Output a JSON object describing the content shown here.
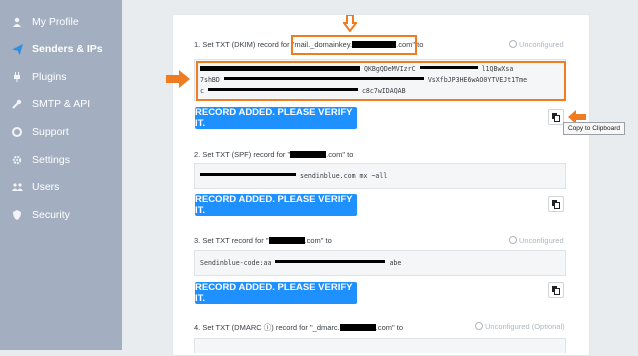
{
  "sidebar": {
    "items": [
      {
        "label": "My Profile",
        "icon": "user-icon",
        "active": false
      },
      {
        "label": "Senders & IPs",
        "icon": "paper-plane-icon",
        "active": true
      },
      {
        "label": "Plugins",
        "icon": "plug-icon",
        "active": false
      },
      {
        "label": "SMTP & API",
        "icon": "wrench-icon",
        "active": false
      },
      {
        "label": "Support",
        "icon": "life-ring-icon",
        "active": false
      },
      {
        "label": "Settings",
        "icon": "gear-icon",
        "active": false
      },
      {
        "label": "Users",
        "icon": "users-icon",
        "active": false
      },
      {
        "label": "Security",
        "icon": "shield-icon",
        "active": false
      }
    ]
  },
  "steps": {
    "dkim": {
      "label_prefix": "1. Set TXT (DKIM) record for \"mail._domainkey.",
      "label_suffix": ".com\" to",
      "status": "Unconfigured",
      "code_fragments": [
        "QKBgQDeMVIzrC",
        "l1QBwXsa",
        "7shBD",
        "VsXfbJP3HE6wAO0YTVEJt1Tme",
        "c",
        "c8c7wIDAQAB"
      ],
      "button": "RECORD ADDED. PLEASE VERIFY IT."
    },
    "spf": {
      "label_prefix": "2. Set TXT (SPF) record for \"",
      "label_suffix": ".com\" to",
      "code": "sendinblue.com mx ~all",
      "button": "RECORD ADDED. PLEASE VERIFY IT."
    },
    "code3": {
      "label_prefix": "3. Set TXT record for \"",
      "label_suffix": ".com\" to",
      "status": "Unconfigured",
      "code_prefix": "Sendinblue-code:aa",
      "code_suffix": "abe",
      "button": "RECORD ADDED. PLEASE VERIFY IT."
    },
    "dmarc": {
      "label_prefix": "4. Set TXT (DMARC ⓘ) record for \"_dmarc.",
      "label_suffix": ".com\" to",
      "status": "Unconfigured (Optional)"
    }
  },
  "tooltip": "Copy to Clipboard",
  "colors": {
    "accent": "#1e90ff",
    "highlight": "#f07c22",
    "sidebar": "#a3afc0"
  }
}
